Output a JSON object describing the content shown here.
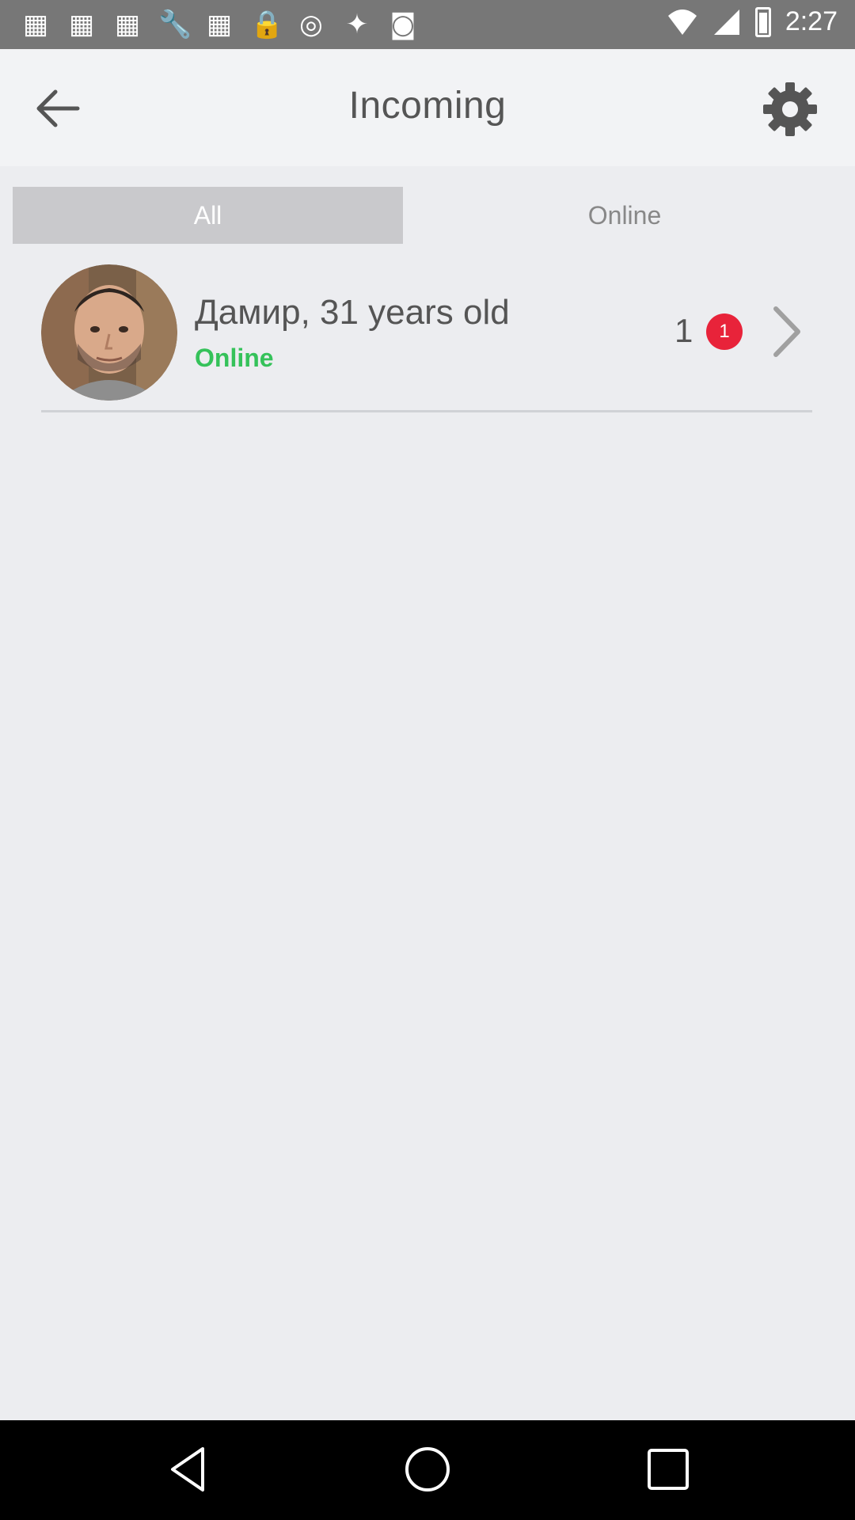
{
  "status_bar": {
    "time": "2:27",
    "icons": [
      "grid-icon",
      "grid-icon",
      "grid-icon",
      "wrench-icon",
      "grid-icon",
      "lock-icon",
      "alert-icon",
      "satellite-icon",
      "android-icon"
    ]
  },
  "header": {
    "title": "Incoming",
    "back_icon": "arrow-back-icon",
    "settings_icon": "gear-icon"
  },
  "tabs": [
    {
      "label": "All",
      "selected": true
    },
    {
      "label": "Online",
      "selected": false
    }
  ],
  "list": [
    {
      "name": "Дамир, 31 years old",
      "status": "Online",
      "count": "1",
      "badge": "1"
    }
  ],
  "colors": {
    "online_green": "#35c25a",
    "badge_red": "#e8233a",
    "tab_selected": "#c9c9cc",
    "background": "#ecedf0"
  }
}
